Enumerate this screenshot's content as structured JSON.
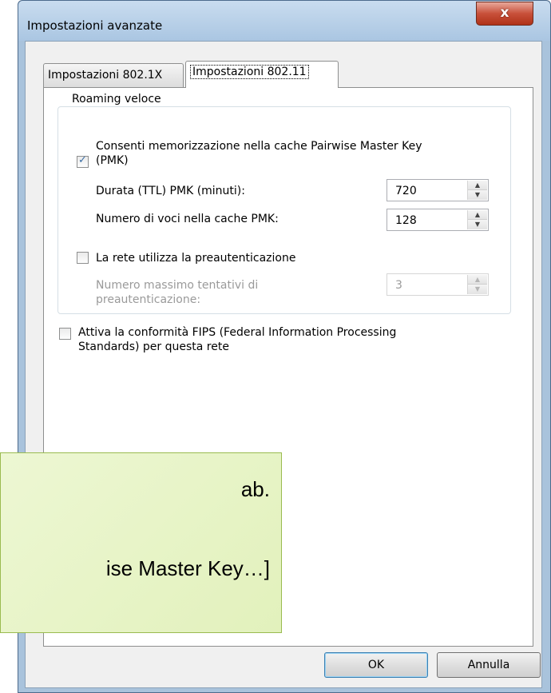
{
  "window": {
    "title": "Impostazioni avanzate",
    "close_label": "x"
  },
  "tabs": [
    {
      "label": "Impostazioni 802.1X",
      "active": false
    },
    {
      "label": "Impostazioni 802.11",
      "active": true
    }
  ],
  "roaming": {
    "group_label": "Roaming veloce",
    "pmk_cache": {
      "label_line1": "Consenti memorizzazione nella cache Pairwise Master Key",
      "label_line2": "(PMK)",
      "checked": true
    },
    "ttl": {
      "label": "Durata (TTL) PMK (minuti):",
      "value": "720"
    },
    "cache_entries": {
      "label": "Numero di voci nella cache PMK:",
      "value": "128"
    },
    "preauth": {
      "label": "La rete utilizza la preautenticazione",
      "checked": false
    },
    "max_attempts": {
      "label_line1": "Numero massimo tentativi di",
      "label_line2": "preautenticazione:",
      "value": "3",
      "disabled": true
    }
  },
  "fips": {
    "label_line1": "Attiva la conformità FIPS (Federal Information Processing",
    "label_line2": "Standards) per questa rete",
    "checked": false
  },
  "buttons": {
    "ok": "OK",
    "cancel": "Annulla"
  },
  "callout": {
    "line1": "ab.",
    "line2": "ise Master Key…]"
  },
  "colors": {
    "callout_bg": "#e6f3c4",
    "callout_border": "#9abb50",
    "titlebar": "#b4cde6",
    "close_button": "#c8503a"
  }
}
